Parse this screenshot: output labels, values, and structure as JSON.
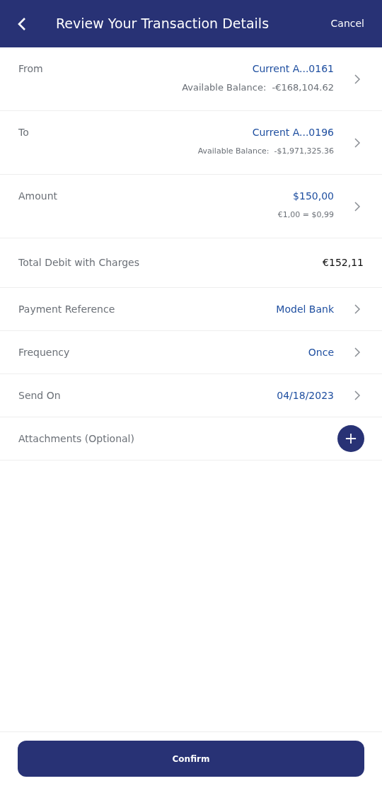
{
  "header": {
    "title": "Review Your Transaction Details",
    "cancel": "Cancel"
  },
  "rows": [
    {
      "kind": "account",
      "label": "From",
      "value": "Current A...0161",
      "sub": "Available Balance:  -€168,104.62"
    },
    {
      "kind": "account",
      "label": "To",
      "value": "Current A...0196",
      "sub": "Available Balance:  -$1,971,325.36"
    },
    {
      "kind": "account",
      "label": "Amount",
      "value": "$150,00",
      "sub": "€1,00 = $0,99"
    },
    {
      "kind": "plain",
      "label": "Total Debit with Charges",
      "value": "€152,11"
    },
    {
      "kind": "link",
      "label": "Payment Reference",
      "value": "Model Bank"
    },
    {
      "kind": "link",
      "label": "Frequency",
      "value": "Once"
    },
    {
      "kind": "link",
      "label": "Send On",
      "value": "04/18/2023"
    },
    {
      "kind": "add",
      "label": "Attachments (Optional)"
    }
  ],
  "confirm": "Confirm"
}
